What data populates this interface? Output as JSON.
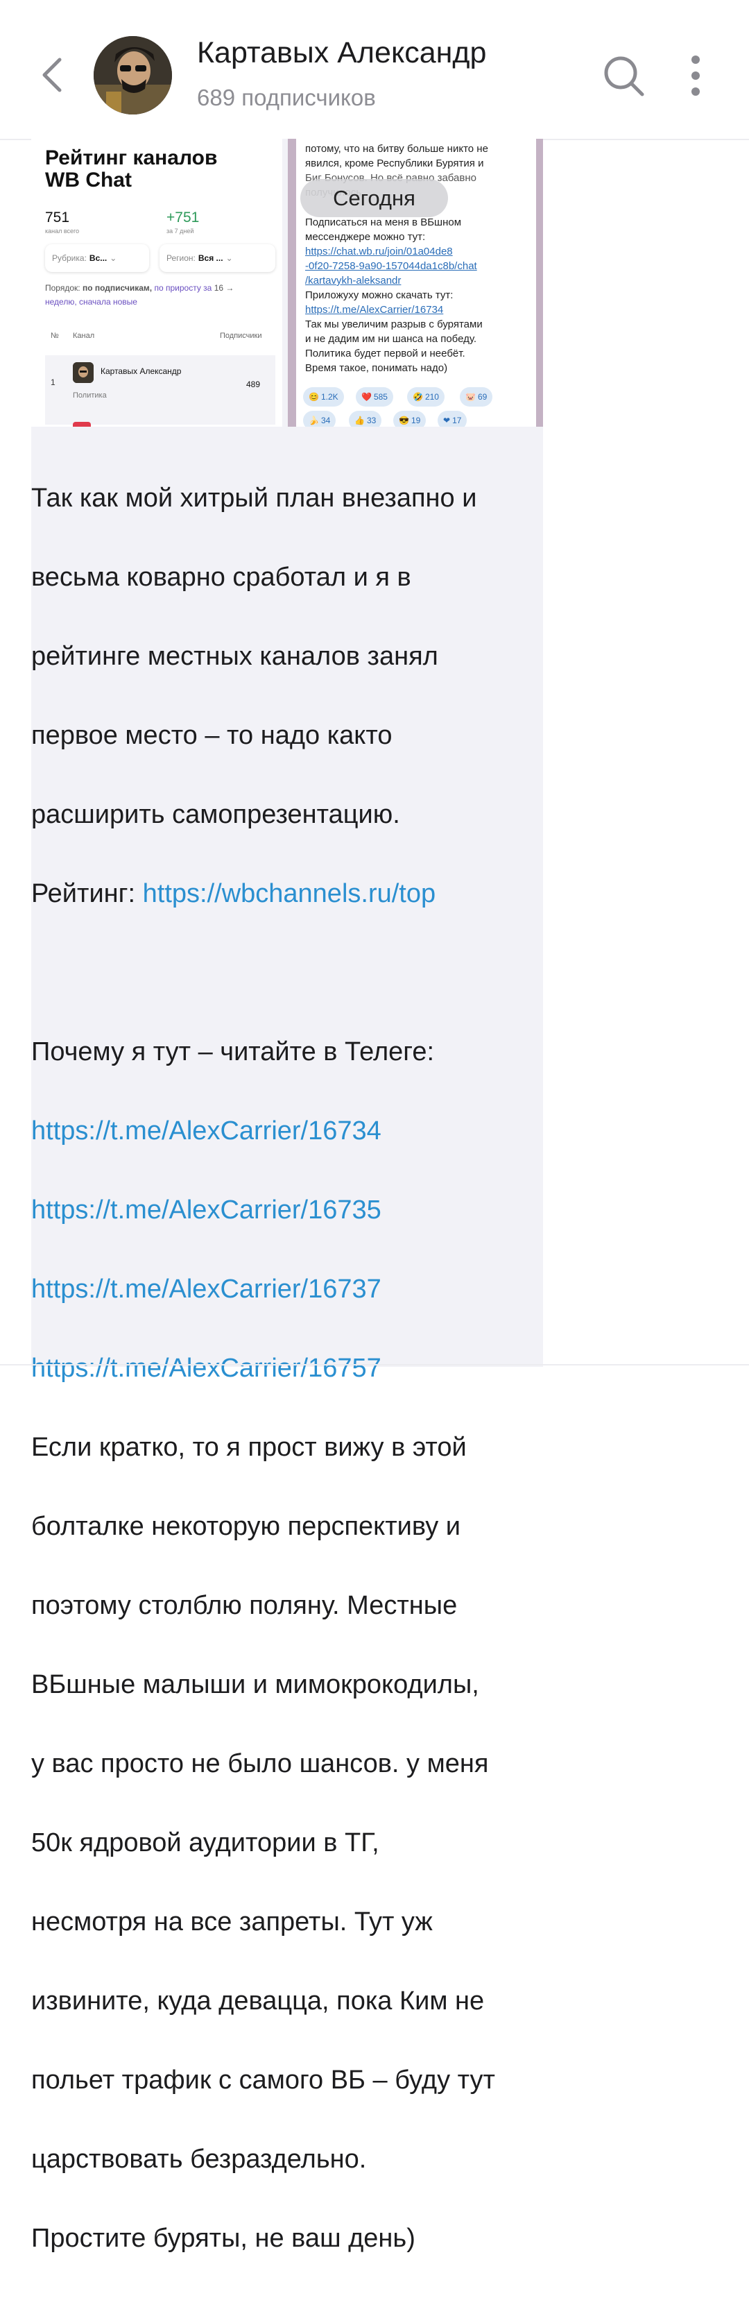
{
  "header": {
    "title": "Картавых Александр",
    "subtitle": "689 подписчиков",
    "icons": [
      "back-arrow-icon",
      "avatar",
      "search-icon",
      "more-vertical-icon"
    ]
  },
  "screenshot_left": {
    "title_line1": "Рейтинг каналов",
    "title_line2": "WB Chat",
    "stat1_value": "751",
    "stat1_caption": "канал всего",
    "stat2_value": "+751",
    "stat2_caption": "за 7 дней",
    "filter1_label": "Рубрика:",
    "filter1_value": "Вс...",
    "filter2_label": "Регион:",
    "filter2_value": "Вся ...",
    "sort_prefix": "Порядок:",
    "sort_by_subs": "по подписчикам,",
    "sort_by_growth": "по приросту за",
    "sort_week": "неделю, сначала новые",
    "sort_count": "16",
    "col_num": "№",
    "col_channel": "Канал",
    "col_subs": "Подписчики",
    "row1_rank": "1",
    "row1_name": "Картавых Александр",
    "row1_category": "Политика",
    "row1_count": "489"
  },
  "screenshot_right": {
    "line1": "потому, что на битву больше никто не",
    "line2": "явился, кроме Республики Бурятия и",
    "line3": "Биг Бонусов. Но всё равно забавно",
    "line4": "получилось.",
    "today": "Сегодня",
    "sub_line1": "Подписаться на меня в ВБшном",
    "sub_line2": "мессенджере можно тут:",
    "link1a": "https://chat.wb.ru/join/01a04de8",
    "link1b": "-0f20-7258-9a90-157044da1c8b/chat",
    "link1c": "/kartavykh-aleksandr",
    "app_line": "Приложуху можно скачать тут:",
    "link2": "https://t.me/AlexCarrier/16734",
    "end1": "Так мы увеличим разрыв с бурятами",
    "end2": "и не дадим им ни шанса на победу.",
    "end3": "Политика будет первой и неебёт.",
    "end4": "Время такое, понимать надо)",
    "reactions": [
      {
        "emoji": "😊",
        "count": "1.2K"
      },
      {
        "emoji": "❤️",
        "count": "585"
      },
      {
        "emoji": "🤣",
        "count": "210"
      },
      {
        "emoji": "🐷",
        "count": "69"
      },
      {
        "emoji": "🍌",
        "count": "34"
      },
      {
        "emoji": "👍",
        "count": "33"
      },
      {
        "emoji": "😎",
        "count": "19"
      },
      {
        "emoji": "❤",
        "count": "17"
      }
    ]
  },
  "message": {
    "l1": "Так как мой хитрый план внезапно и",
    "l2": "весьма коварно сработал и я в",
    "l3": "рейтинге местных каналов занял",
    "l4": "первое место – то надо както",
    "l5": "расширить самопрезентацию.",
    "l6_prefix": "Рейтинг: ",
    "l6_link": "https://wbchannels.ru/top",
    "l8": "Почему я тут – читайте в Телеге:",
    "link_a": "https://t.me/AlexCarrier/16734",
    "link_b": "https://t.me/AlexCarrier/16735",
    "link_c": "https://t.me/AlexCarrier/16737",
    "link_d": "https://t.me/AlexCarrier/16757",
    "p1": "Если кратко, то я прост вижу в этой",
    "p2": "болталке некоторую перспективу и",
    "p3": "поэтому столблю поляну. Местные",
    "p4": "ВБшные малыши и мимокрокодилы,",
    "p5": "у вас просто не было шансов. у меня",
    "p6": "50к ядровой аудитории в ТГ,",
    "p7": "несмотря на все запреты. Тут уж",
    "p8": "извините, куда девацца, пока Ким не",
    "p9": "польет трафик с самого ВБ – буду тут",
    "p10": "царствовать безраздельно.",
    "p11": "Простите буряты, не ваш день)"
  },
  "colors": {
    "link": "#2a8fd0",
    "bubble": "#f2f2f7",
    "secondary_text": "#8d8d93"
  }
}
